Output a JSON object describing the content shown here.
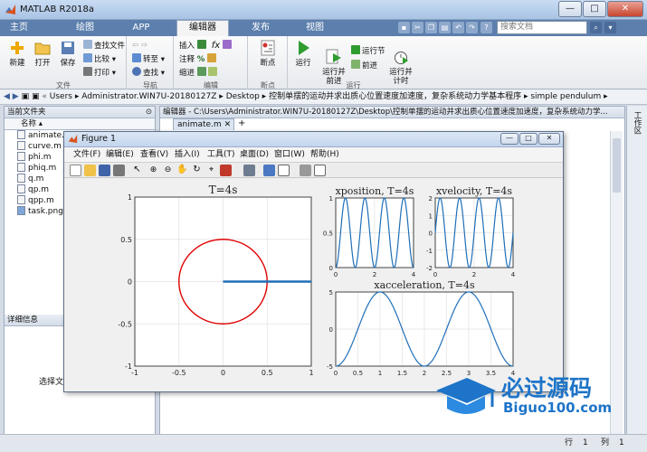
{
  "window": {
    "title": "MATLAB R2018a"
  },
  "ribbon_tabs": [
    "主页",
    "绘图",
    "APP",
    "编辑器",
    "发布",
    "视图"
  ],
  "search_placeholder": "搜索文档",
  "ribbon": {
    "file": {
      "new": "新建",
      "open": "打开",
      "save": "保存",
      "find_files": "查找文件",
      "compare": "比较",
      "print": "打印",
      "label": "文件"
    },
    "navigate": {
      "goto": "转至",
      "find": "查找",
      "label": "导航"
    },
    "edit": {
      "insert": "插入",
      "comment": "注释",
      "indent": "缩进",
      "fx": "fx",
      "label": "编辑"
    },
    "breakpoints": {
      "label": "断点",
      "btn": "断点"
    },
    "run": {
      "run": "运行",
      "run_advance": "运行并\n前进",
      "run_section": "运行节",
      "advance": "前进",
      "run_time": "运行并\n计时",
      "label": "运行"
    }
  },
  "address": [
    "Users",
    "Administrator.WIN7U-20180127Z",
    "Desktop",
    "控制单摆的运动并求出质心位置速度加速度，复杂系统动力学基本程序",
    "simple pendulum"
  ],
  "current_folder": {
    "title": "当前文件夹",
    "col_name": "名称",
    "files": [
      {
        "name": "animate.m",
        "type": "m"
      },
      {
        "name": "curve.m",
        "type": "m"
      },
      {
        "name": "phi.m",
        "type": "m"
      },
      {
        "name": "phiq.m",
        "type": "m"
      },
      {
        "name": "q.m",
        "type": "m"
      },
      {
        "name": "qp.m",
        "type": "m"
      },
      {
        "name": "qpp.m",
        "type": "m"
      },
      {
        "name": "task.png",
        "type": "png"
      }
    ],
    "details_title": "详细信息",
    "select_hint": "选择文"
  },
  "editor": {
    "header": "编辑器 - C:\\Users\\Administrator.WIN7U-20180127Z\\Desktop\\控制单摆的运动并求出质心位置速度加速度，复杂系统动力学...",
    "tab": "animate.m"
  },
  "right_strip_label": "工作区",
  "status": {
    "row_label": "行",
    "row": "1",
    "col_label": "列",
    "col": "1"
  },
  "figure": {
    "title": "Figure 1",
    "menu": [
      "文件(F)",
      "编辑(E)",
      "查看(V)",
      "插入(I)",
      "工具(T)",
      "桌面(D)",
      "窗口(W)",
      "帮助(H)"
    ],
    "buttons": {
      "min": "—",
      "max": "□",
      "close": "✕"
    }
  },
  "watermark": {
    "cn": "必过源码",
    "en": "Biguo100.com"
  },
  "chart_data": [
    {
      "type": "line",
      "title": "T=4s",
      "xlim": [
        -1,
        1
      ],
      "ylim": [
        -1,
        1
      ],
      "xticks": [
        "-1",
        "-0.5",
        "0",
        "0.5",
        "1"
      ],
      "yticks": [
        "1",
        "0.5",
        "0",
        "-0.5",
        "-1"
      ],
      "series": [
        {
          "kind": "circle",
          "center": [
            0,
            0
          ],
          "radius": 0.5,
          "color": "#e00000"
        },
        {
          "kind": "segment",
          "x": [
            0,
            1
          ],
          "y": [
            0,
            0
          ],
          "color": "#1f6fb8"
        }
      ]
    },
    {
      "type": "line",
      "title": "xposition, T=4s",
      "xlim": [
        0,
        4
      ],
      "ylim": [
        0,
        1
      ],
      "xticks": [
        "0",
        "2",
        "4"
      ],
      "yticks": [
        "1",
        "0.5",
        "0"
      ],
      "series": [
        {
          "fn": "0.5-0.5*cos(2*pi*x)",
          "color": "#1f6fb8"
        }
      ]
    },
    {
      "type": "line",
      "title": "xvelocity, T=4s",
      "xlim": [
        0,
        4
      ],
      "ylim": [
        -2,
        2
      ],
      "xticks": [
        "0",
        "2",
        "4"
      ],
      "yticks": [
        "2",
        "1",
        "0",
        "-1",
        "-2"
      ],
      "series": [
        {
          "fn": "2*sin(2*pi*x)",
          "color": "#1f6fb8"
        }
      ]
    },
    {
      "type": "line",
      "title": "xacceleration, T=4s",
      "xlim": [
        0,
        4
      ],
      "ylim": [
        -5,
        5
      ],
      "xticks": [
        "0",
        "0.5",
        "1",
        "1.5",
        "2",
        "2.5",
        "3",
        "3.5",
        "4"
      ],
      "yticks": [
        "5",
        "0",
        "-5"
      ],
      "series": [
        {
          "fn": "-5*cos(pi*x)",
          "color": "#1f6fb8"
        }
      ]
    }
  ]
}
